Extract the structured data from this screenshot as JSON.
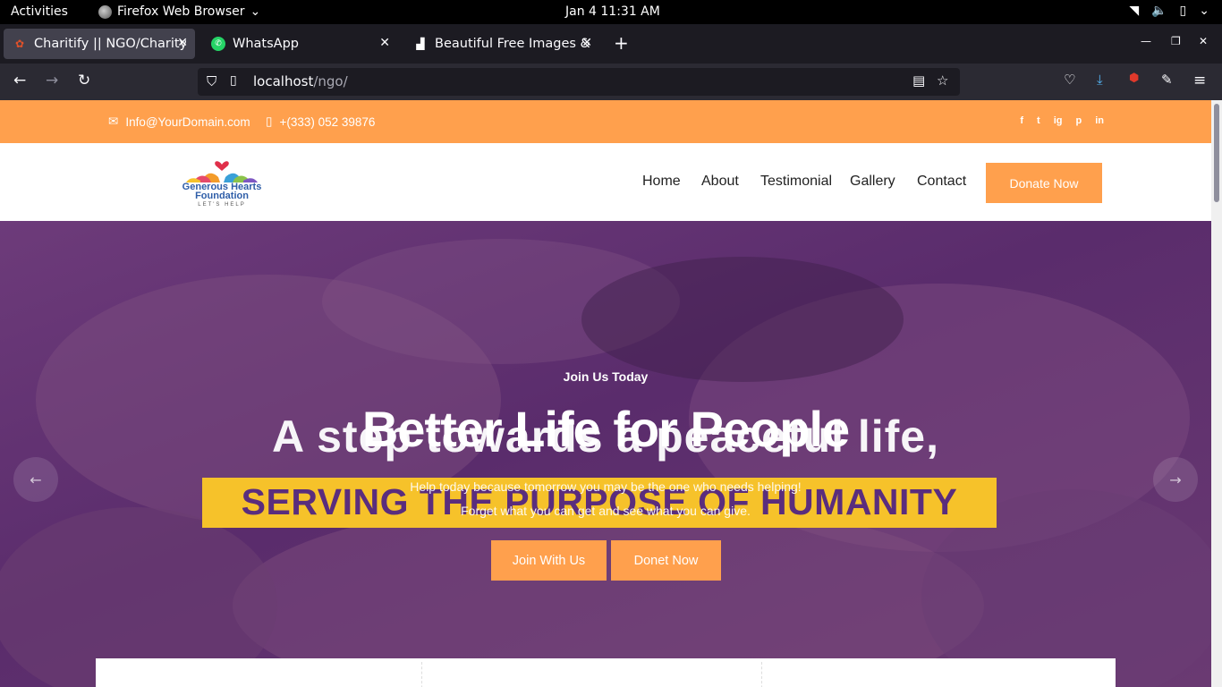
{
  "system": {
    "activities": "Activities",
    "app_name": "Firefox Web Browser",
    "clock": "Jan 4  11:31 AM"
  },
  "browser": {
    "tabs": [
      {
        "title": "Charitify || NGO/Charity/H",
        "active": true
      },
      {
        "title": "WhatsApp",
        "active": false
      },
      {
        "title": "Beautiful Free Images & P",
        "active": false
      }
    ],
    "url_host": "localhost",
    "url_path": "/ngo/"
  },
  "topbar": {
    "email": "Info@YourDomain.com",
    "phone": "+(333) 052 39876",
    "social": [
      "f",
      "t",
      "ig",
      "p",
      "in"
    ]
  },
  "header": {
    "logo_line1": "Generous Hearts",
    "logo_line2": "Foundation",
    "logo_line3": "LET'S HELP",
    "menu": [
      "Home",
      "About",
      "Testimonial",
      "Gallery",
      "Contact"
    ],
    "donate_label": "Donate Now"
  },
  "hero": {
    "tagline": "Join Us Today",
    "image_text_line1": "A step towards a peaceful life,",
    "image_text_line2": "SERVING THE PURPOSE OF HUMANITY",
    "title": "Better Life for People",
    "sub1": "Help today because tomorrow you may be the one who needs helping!",
    "sub2": "Forget what you can get and see what you can give.",
    "btn_join": "Join With Us",
    "btn_donate": "Donet Now"
  },
  "colors": {
    "accent": "#ffa04d",
    "hero_purple": "#5a2c6c",
    "band_yellow": "#f6c22a"
  }
}
